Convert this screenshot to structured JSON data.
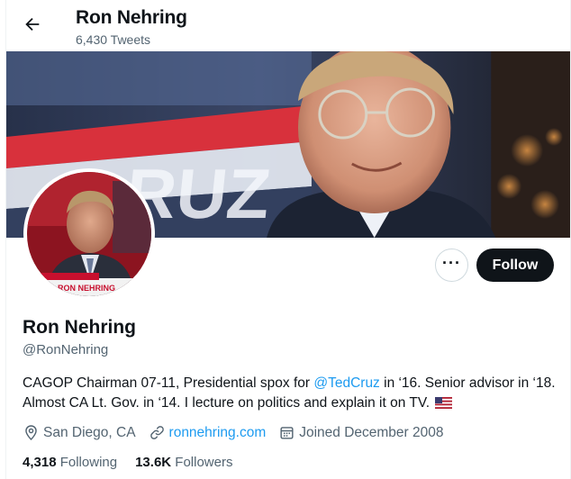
{
  "header": {
    "title": "Ron Nehring",
    "tweet_count": "6,430 Tweets"
  },
  "profile": {
    "name": "Ron Nehring",
    "handle": "@RonNehring",
    "bio": {
      "part1": "CAGOP Chairman 07-11, Presidential spox for ",
      "mention": "@TedCruz",
      "part2": " in ‘16. Senior advisor in ‘18. Almost CA Lt. Gov. in ‘14. I lecture on politics and explain it on TV."
    },
    "location": "San Diego, CA",
    "website": "ronnehring.com",
    "joined": "Joined December 2008",
    "following_count": "4,318",
    "following_label": "Following",
    "followers_count": "13.6K",
    "followers_label": "Followers"
  },
  "actions": {
    "more_label": "···",
    "follow_label": "Follow"
  },
  "banner": {
    "sign_text": "RUZ"
  },
  "avatar": {
    "ticker_text": "RON NEHRING"
  },
  "icons": {
    "back": "arrow-left-icon",
    "location": "location-pin-icon",
    "link": "link-icon",
    "calendar": "calendar-icon",
    "flag": "us-flag-icon"
  },
  "colors": {
    "accent": "#1d9bf0",
    "text_primary": "#0f1419",
    "text_secondary": "#536471",
    "follow_button": "#0f1419"
  }
}
